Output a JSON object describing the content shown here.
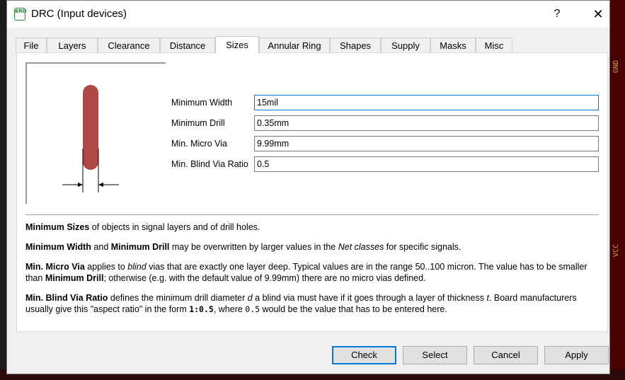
{
  "window": {
    "title": "DRC (Input devices)",
    "icon_text": "BRD",
    "help_label": "?",
    "close_label": "✕"
  },
  "tabs": [
    {
      "label": "File"
    },
    {
      "label": "Layers"
    },
    {
      "label": "Clearance"
    },
    {
      "label": "Distance"
    },
    {
      "label": "Sizes",
      "active": true
    },
    {
      "label": "Annular Ring"
    },
    {
      "label": "Shapes"
    },
    {
      "label": "Supply"
    },
    {
      "label": "Masks"
    },
    {
      "label": "Misc"
    }
  ],
  "fields": [
    {
      "label": "Minimum Width",
      "value": "15mil"
    },
    {
      "label": "Minimum Drill",
      "value": "0.35mm"
    },
    {
      "label": "Min. Micro Via",
      "value": "9.99mm"
    },
    {
      "label": "Min. Blind Via Ratio",
      "value": "0.5"
    }
  ],
  "help": {
    "p1": {
      "b1": "Minimum Sizes",
      "t1": " of objects in signal layers and of drill holes."
    },
    "p2": {
      "b1": "Minimum Width",
      "t1": " and ",
      "b2": "Minimum Drill",
      "t2": " may be overwritten by larger values in the ",
      "i1": "Net classes",
      "t3": " for specific signals."
    },
    "p3": {
      "b1": "Min. Micro Via",
      "t1": " applies to ",
      "i1": "blind",
      "t2": " vias that are exactly one layer deep. Typical values are in the range 50..100 micron. The value has to be smaller than ",
      "b2": "Minimum Drill",
      "t3": "; otherwise (e.g. with the default value of 9.99mm) there are no micro vias defined."
    },
    "p4": {
      "b1": "Min. Blind Via Ratio",
      "t1": " defines the minimum drill diameter ",
      "i1": "d",
      "t2": " a blind via must have if it goes through a layer of thickness ",
      "i2": "t",
      "t3": ". Board manufacturers usually give this \"aspect ratio\" in the form ",
      "m1": "1:0.5",
      "t4": ", where ",
      "m2": "0.5",
      "t5": " would be the value that has to be entered here."
    }
  },
  "buttons": {
    "check": "Check",
    "select": "Select",
    "cancel": "Cancel",
    "apply": "Apply"
  },
  "background": {
    "labels": [
      "GND",
      "VCC"
    ]
  },
  "colors": {
    "trace": "#b04848",
    "focus": "#0078d7",
    "app_icon": "#2e8b3e"
  }
}
